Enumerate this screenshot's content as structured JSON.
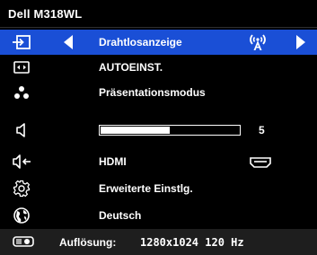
{
  "window": {
    "title": "Dell M318WL"
  },
  "menu": {
    "items": [
      {
        "id": "wireless",
        "icon": "input-source-icon",
        "label": "Drahtlosanzeige",
        "selected": true
      },
      {
        "id": "auto",
        "icon": "auto-adjust-icon",
        "label": "AUTOEINST."
      },
      {
        "id": "presentation",
        "icon": "presentation-mode-icon",
        "label": "Präsentationsmodus"
      },
      {
        "id": "volume",
        "icon": "volume-icon",
        "volume_value": "5",
        "volume_level": 0.5
      },
      {
        "id": "audio_input",
        "icon": "audio-input-icon",
        "label": "HDMI"
      },
      {
        "id": "advanced",
        "icon": "advanced-settings-icon",
        "label": "Erweiterte Einstlg."
      },
      {
        "id": "language",
        "icon": "language-globe-icon",
        "label": "Deutsch"
      }
    ]
  },
  "status": {
    "icon": "projector-icon",
    "label": "Auflösung:",
    "value": "1280x1024 120 Hz"
  },
  "colors": {
    "selected_bg": "#1a4fd6",
    "background": "#000000",
    "text": "#ffffff"
  }
}
